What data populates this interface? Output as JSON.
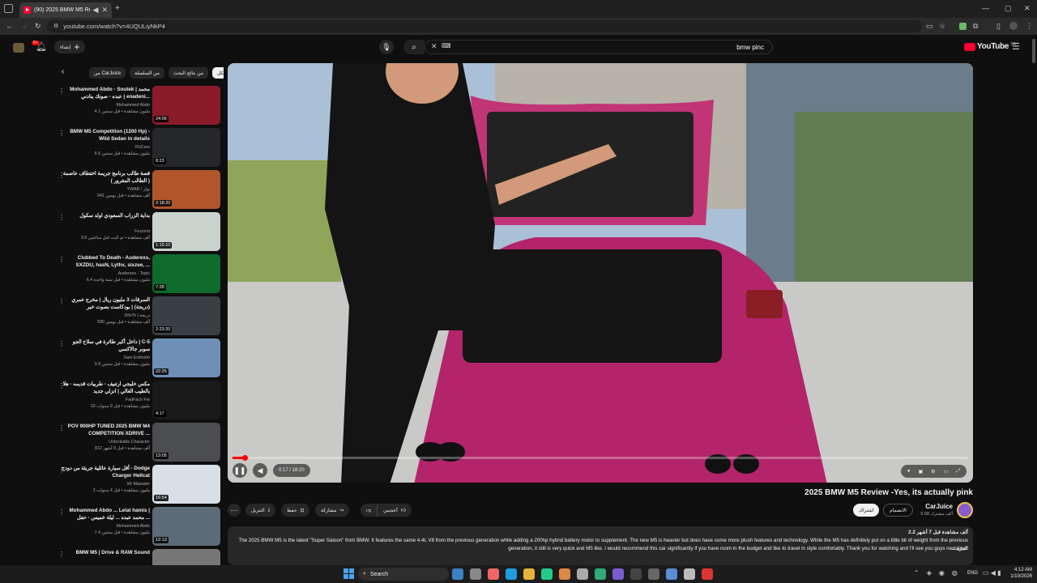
{
  "browser": {
    "tab_title": "(90) 2025 BMW M5 Review",
    "url": "youtube.com/watch?v=4UQULiyNkP4"
  },
  "youtube": {
    "search_query": "bmw pinc",
    "create_label": "إنشاء",
    "logo_text": "YouTube",
    "logo_region": "SA",
    "notif_count": "9+"
  },
  "sidebar": {
    "chips": [
      "الكل",
      "من نتائج البحث",
      "من السلسلة",
      "من CarJuice"
    ],
    "items": [
      {
        "title": "Mohammed Abdo - Soutek | محمد عبده - صوتك ينادني | enadeni...",
        "channel": "Mohammed Abdo",
        "meta": "4.1 مليون مشاهدة • قبل سنتين",
        "duration": "24:06",
        "thumb": "#8a1c2a"
      },
      {
        "title": "BMW M5 Competition (1200 Hp) - Wild Sedan in details",
        "channel": "RoCars",
        "meta": "6.6 مليون مشاهدة • قبل سنتين",
        "duration": "8:23",
        "thumb": "#25272b"
      },
      {
        "title": "قصة طالب برنامج جريمة اختطاف عاصمة ( الطالب المغرور )",
        "channel": "YWAR / يوار",
        "meta": "941 ألف مشاهدة • قبل يومين",
        "duration": "2:18:20",
        "thumb": "#b0562a"
      },
      {
        "title": "بداية الزراب السعودي اولد سكول",
        "channel": "Fezzent",
        "meta": "3.6 ألف مشاهدة • تم البث قبل ساعتين",
        "duration": "1:15:10",
        "thumb": "#c9d2cc"
      },
      {
        "title": "Clubbed To Death - Auderexs, SXZDU, hasN, Lythx, sixzee, ...",
        "channel": "Auderexs - Topic",
        "meta": "6.4 مليون مشاهدة • قبل سنة واحدة",
        "duration": "7:28",
        "thumb": "#0e6b2c"
      },
      {
        "title": "السرقات 3 مليون ريال | مخرج عمري (دريجة) | بودكاست بصوت خبر",
        "channel": "Drb7h | دريجة",
        "meta": "590 ألف مشاهدة • قبل يومين",
        "duration": "2:23:20",
        "thumb": "#3a3f44"
      },
      {
        "title": "داخل أكبر طائرة في سلاح الجو | C-5 سوبر جالاكسي",
        "channel": "Sam Eckholm",
        "meta": "3.9 مليون مشاهدة • قبل سنتين",
        "duration": "22:25",
        "thumb": "#6f8fb6"
      },
      {
        "title": "مكس خليجي ارتنيف - طربيات قديمه - هلا بالطيب الغالي | انزلي جديد",
        "channel": "FadFach Fm",
        "meta": "10 مليون مشاهدة • قبل 9 سنوات",
        "duration": "4:17",
        "thumb": "#1a1a1a"
      },
      {
        "title": "POV 900HP TUNED 2025 BMW M4 COMPETITION XDRIVE ...",
        "channel": "Unlockable Character",
        "meta": "812 ألف مشاهدة • قبل 9 أشهر",
        "duration": "13:05",
        "thumb": "#4b4d50"
      },
      {
        "title": "أقل سيارة عائلية جريئة من دودج - Dodge Charger Hellcat",
        "channel": "Mr Mawater",
        "meta": "2 مليون مشاهدة • قبل 4 سنوات",
        "duration": "16:54",
        "thumb": "#d8dfe6"
      },
      {
        "title": "Mohammed Abdo ... Lelat hamis | محمد عبده ... ليلة خميس - حفل ...",
        "channel": "Mohammed Abdo",
        "meta": "7.4 مليون مشاهدة • قبل سنتين",
        "duration": "12:13",
        "thumb": "#5d6a78"
      },
      {
        "title": "BMW M5 | Drive & RAW Sound",
        "channel": "",
        "meta": "",
        "duration": "",
        "thumb": "#777"
      }
    ]
  },
  "player": {
    "time": "0:17 / 16:20",
    "progress": 0.017
  },
  "video": {
    "title": "2025 BMW M5 Review -Yes, its actually pink",
    "channel": "CarJuice",
    "subs": "9.58 ألف مشترك",
    "join": "الانضمام",
    "subscribe": "اشتراك",
    "like": "أعجبني",
    "share": "مشاركة",
    "save": "حفظ",
    "download": "التنزيل",
    "views": "2.2 ألف مشاهدة قبل 7 أشهر",
    "description": "The 2025 BMW M5 is the latest \"Super Saloon\" from BMW. It features the same 4.4L V8 from the previous generation while adding a 200hp hybrid battery motor to supplement. The new M5 is heavier but does have some more plush features and technology. While the M5 has definitely put on a little bit of weight from the previous generation, it still is very quick and M5 like. I would recommend this car significantly if you have room in the budget and like to travel in style comfortably. Thank you for watching and I'll see you guys next time.",
    "more": "...المزيد"
  },
  "taskbar": {
    "search": "Search",
    "lang": "ENG",
    "time": "4:12 AM",
    "date": "1/10/2026"
  }
}
